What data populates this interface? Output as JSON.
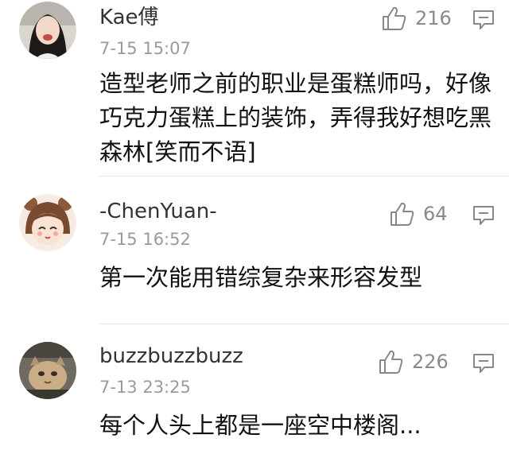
{
  "comments": [
    {
      "username": "Kae傅",
      "timestamp": "7-15 15:07",
      "content": "造型老师之前的职业是蛋糕师吗，好像巧克力蛋糕上的装饰，弄得我好想吃黑森林[笑而不语]",
      "likes": "216",
      "like_icon": "thumbs-up-icon",
      "reply_icon": "comment-icon"
    },
    {
      "username": "-ChenYuan-",
      "timestamp": "7-15 16:52",
      "content": "第一次能用错综复杂来形容发型",
      "likes": "64",
      "like_icon": "thumbs-up-icon",
      "reply_icon": "comment-icon"
    },
    {
      "username": "buzzbuzzbuzz",
      "timestamp": "7-13 23:25",
      "content": "每个人头上都是一座空中楼阁...",
      "likes": "226",
      "like_icon": "thumbs-up-icon",
      "reply_icon": "comment-icon"
    }
  ],
  "colors": {
    "text_primary": "#111111",
    "text_secondary": "#9a9a9a",
    "divider": "#e6e6e6"
  }
}
